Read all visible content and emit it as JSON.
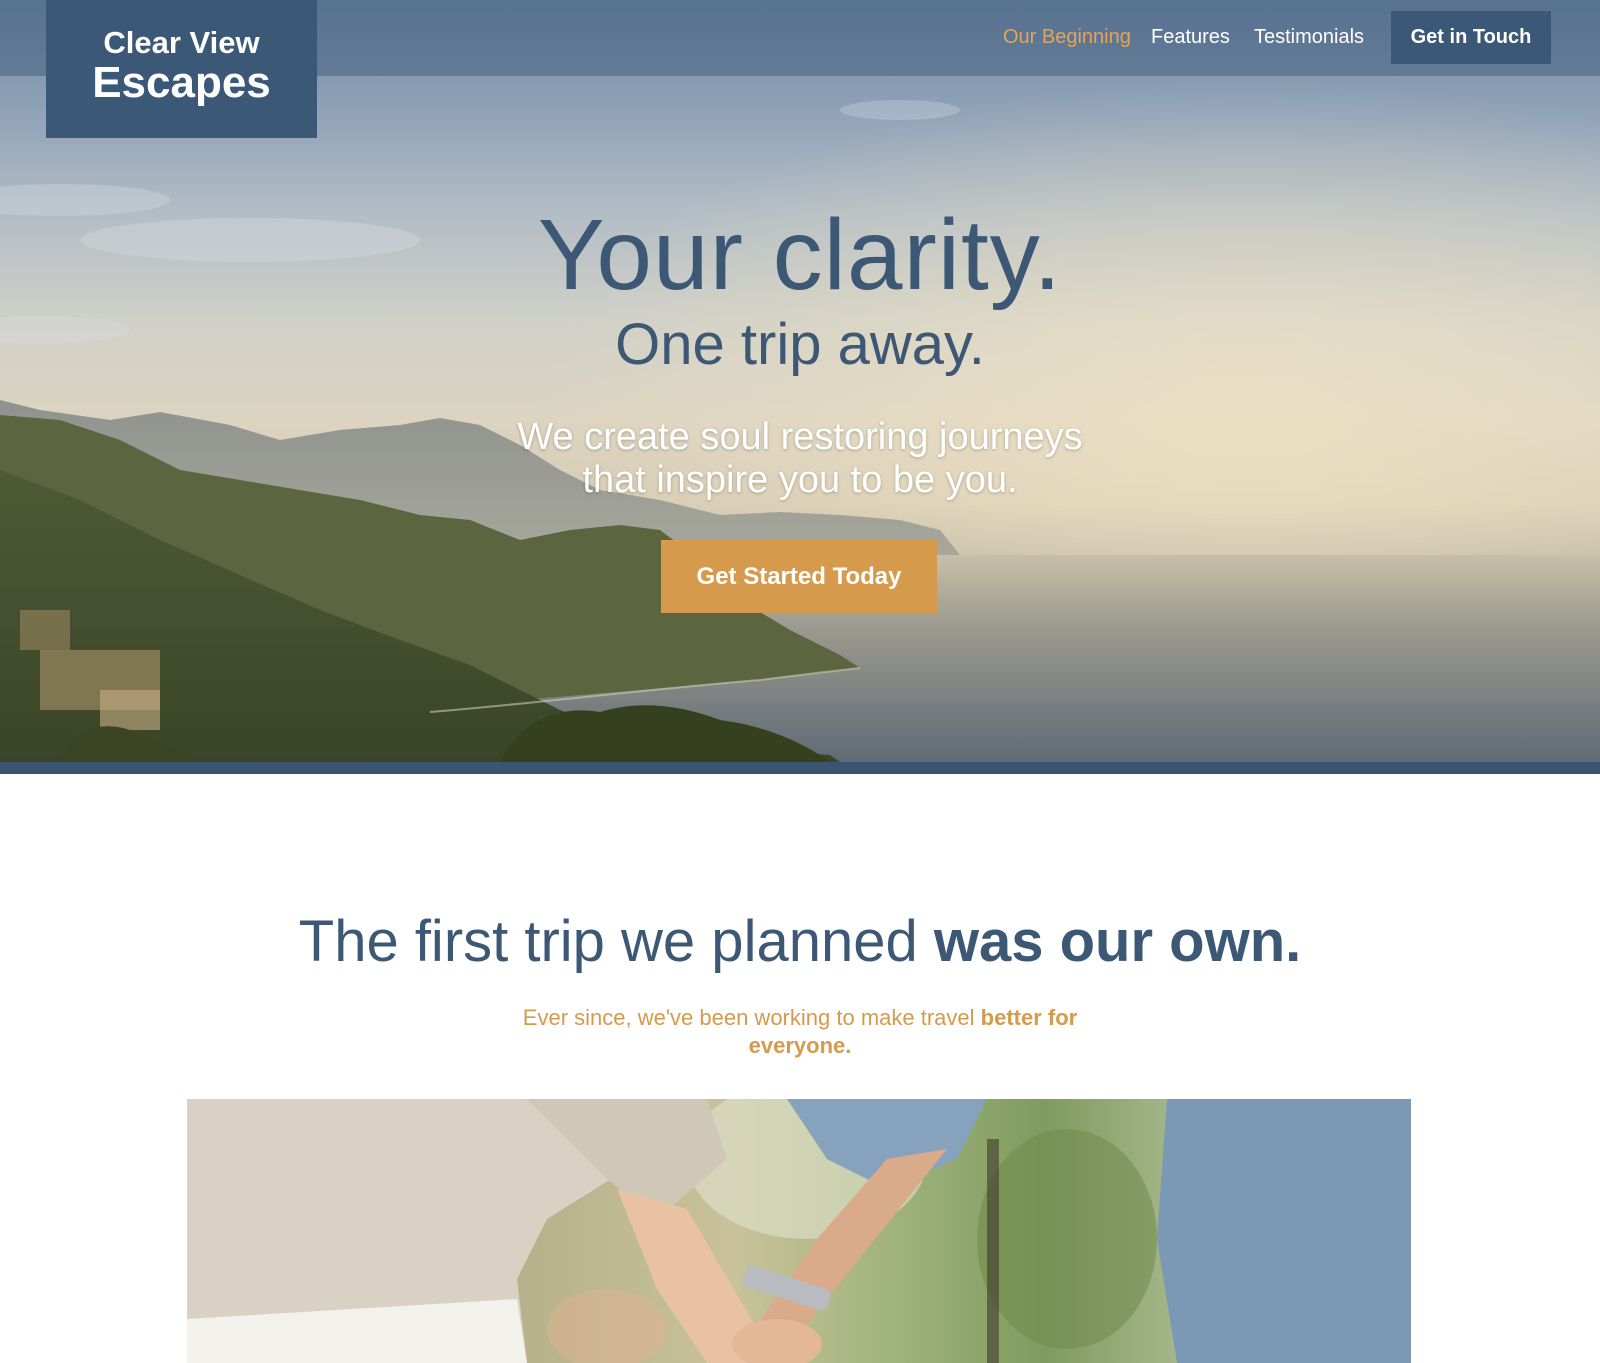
{
  "brand": {
    "line1": "Clear View",
    "line2": "Escapes"
  },
  "nav": {
    "items": [
      {
        "label": "Our Beginning",
        "active": true
      },
      {
        "label": "Features",
        "active": false
      },
      {
        "label": "Testimonials",
        "active": false
      }
    ],
    "cta_label": "Get in Touch"
  },
  "hero": {
    "title": "Your clarity.",
    "subtitle": "One trip away.",
    "tagline_line1": "We create soul restoring journeys",
    "tagline_line2": "that inspire you to be you.",
    "cta_label": "Get Started Today"
  },
  "story": {
    "heading_light": "The first trip we planned ",
    "heading_bold": "was our own.",
    "sub_light": "Ever since, we've been working to make travel ",
    "sub_bold": "better for everyone."
  },
  "colors": {
    "navy": "#3b5877",
    "gold": "#d59a4c",
    "nav_active": "#e5a458",
    "heading_text": "#3d5875"
  }
}
